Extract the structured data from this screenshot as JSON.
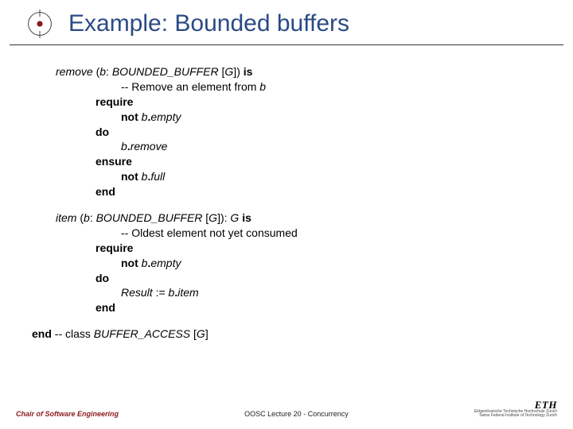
{
  "header": {
    "title": "Example: Bounded buffers"
  },
  "routine1": {
    "sig_name": "remove",
    "sig_open": " (",
    "sig_param": "b",
    "sig_colon": ": ",
    "sig_type": "BOUNDED_BUFFER ",
    "sig_br_open": "[",
    "sig_g": "G",
    "sig_br_close": "]",
    "sig_close": ") ",
    "sig_is": "is",
    "comment_prefix": "-- Remove an element from ",
    "comment_var": "b",
    "require": "require",
    "not1": "not ",
    "b1": "b",
    "dot1": ".",
    "empty": "empty",
    "do": "do",
    "b2": "b",
    "dot2": ".",
    "remove": "remove",
    "ensure": "ensure",
    "not2": "not ",
    "b3": "b",
    "dot3": ".",
    "full": "full",
    "end": "end"
  },
  "routine2": {
    "sig_name": "item",
    "sig_open": " (",
    "sig_param": "b",
    "sig_colon": ": ",
    "sig_type": "BOUNDED_BUFFER ",
    "sig_br_open": "[",
    "sig_g": "G",
    "sig_br_close": "]",
    "sig_close": "): ",
    "sig_ret": "G",
    "sig_space": " ",
    "sig_is": "is",
    "comment": "-- Oldest element not yet consumed",
    "require": "require",
    "not1": "not ",
    "b1": "b",
    "dot1": ".",
    "empty": "empty",
    "do": "do",
    "result": "Result ",
    "assign": ":= ",
    "b2": "b",
    "dot2": ".",
    "item": "item",
    "end": "end"
  },
  "closing": {
    "end": "end",
    "comment_prefix": " -- class ",
    "class": "BUFFER_ACCESS ",
    "br_open": "[",
    "g": "G",
    "br_close": "]"
  },
  "footer": {
    "chair": "Chair of Software Engineering",
    "lecture": "OOSC  Lecture 20 - Concurrency",
    "eth": "ETH",
    "eth_sub1": "Eidgenössische Technische Hochschule Zürich",
    "eth_sub2": "Swiss Federal Institute of Technology Zurich"
  }
}
